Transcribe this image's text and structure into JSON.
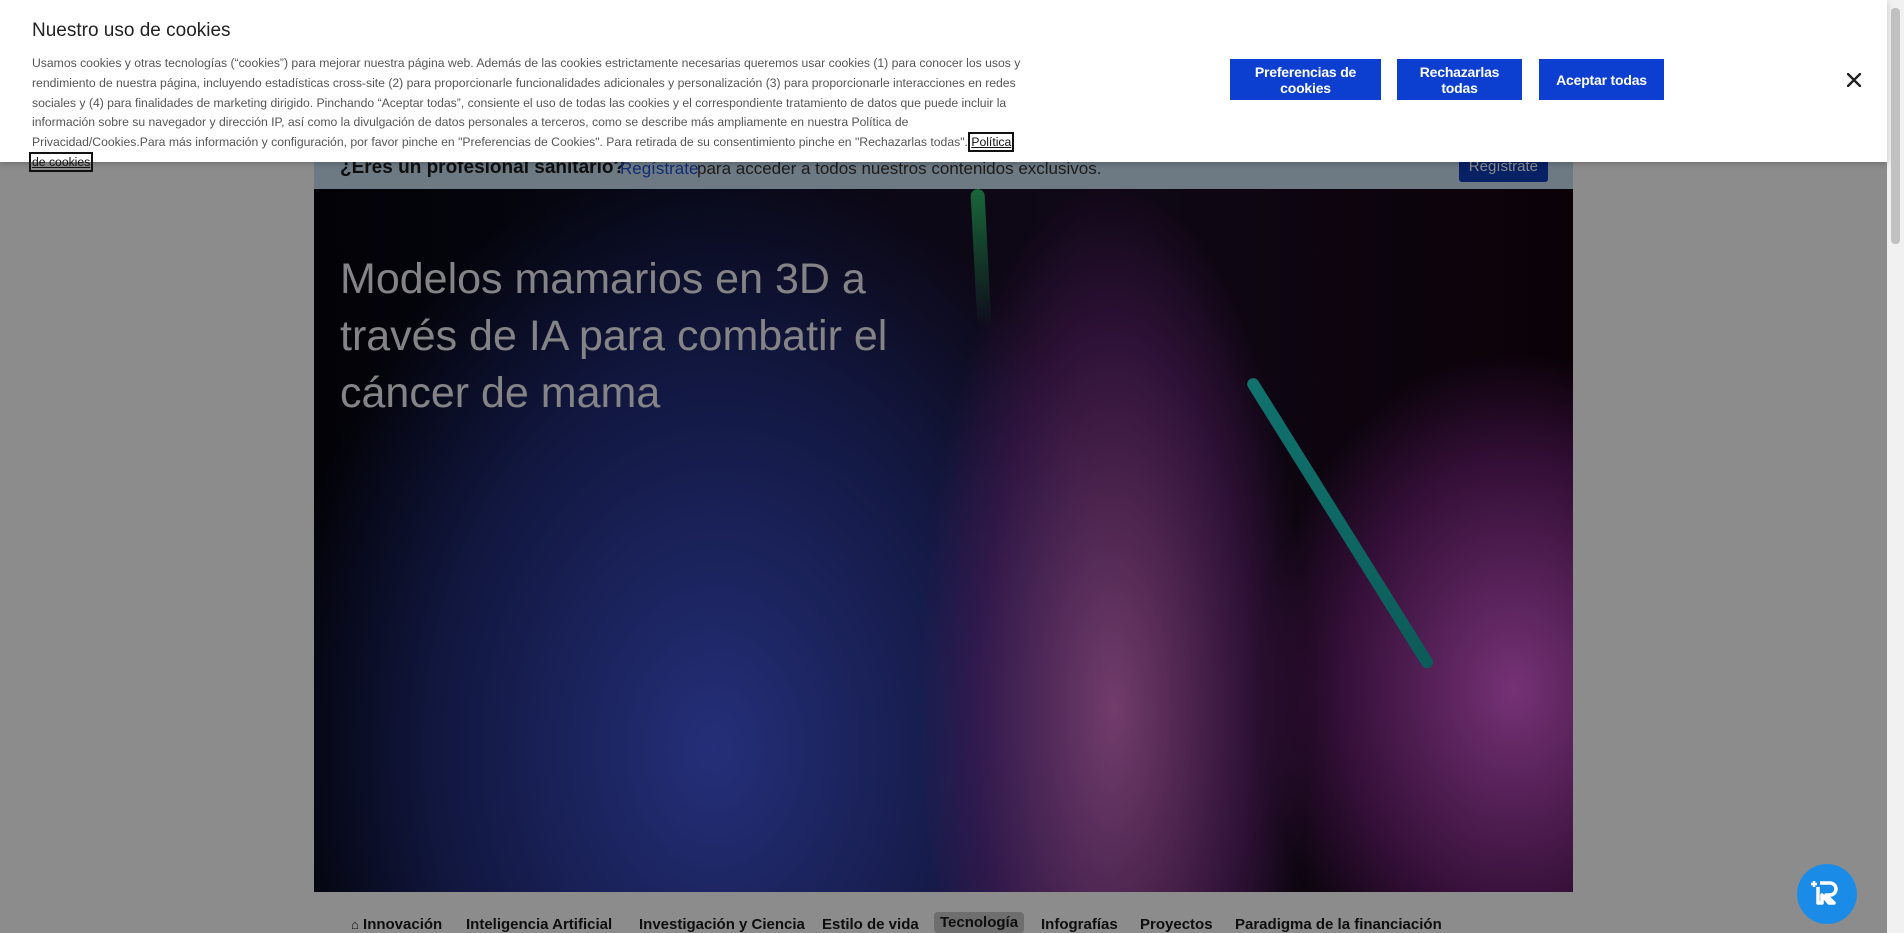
{
  "cookie_banner": {
    "title": "Nuestro uso de cookies",
    "description": "Usamos cookies y otras tecnologías (“cookies”) para mejorar nuestra página web. Además de las cookies estrictamente necesarias queremos usar cookies (1) para conocer los usos y rendimiento de nuestra página, incluyendo estadísticas cross-site (2) para proporcionarle funcionalidades adicionales y personalización (3) para proporcionarle interacciones en redes sociales y (4) para finalidades de marketing dirigido. Pinchando “Aceptar todas”, consiente el uso de todas las cookies y el correspondiente tratamiento de datos que puede incluir la información sobre su navegador y dirección IP, así como la divulgación de datos personales a terceros, como se describe más ampliamente en nuestra Política de Privacidad/Cookies.Para más información y configuración, por favor pinche en \"Preferencias de Cookies\". Para retirada de su consentimiento pinche en \"Rechazarlas todas\". ",
    "policy_link": "Política de cookies",
    "preferences_label": "Preferencias de cookies",
    "reject_label": "Rechazarlas todas",
    "accept_label": "Aceptar todas",
    "close_icon": "close-icon"
  },
  "pro_bar": {
    "question": "¿Eres un profesional sanitario?",
    "link": "Regístrate",
    "rest": " para acceder a todos nuestros contenidos exclusivos.",
    "button": "Regístrate"
  },
  "hero": {
    "title": "Modelos mamarios en 3D a través de IA para combatir el cáncer de mama"
  },
  "nav": {
    "items": [
      {
        "label": "Innovación",
        "icon": "home-icon"
      },
      {
        "label": "Inteligencia Artificial"
      },
      {
        "label": "Investigación y Ciencia"
      },
      {
        "label": "Estilo de vida"
      },
      {
        "label": "Tecnología",
        "active": true
      },
      {
        "label": "Infografías"
      },
      {
        "label": "Proyectos"
      },
      {
        "label": "Paradigma de la financiación"
      }
    ]
  },
  "widget": {
    "icon": "assistant-icon"
  }
}
